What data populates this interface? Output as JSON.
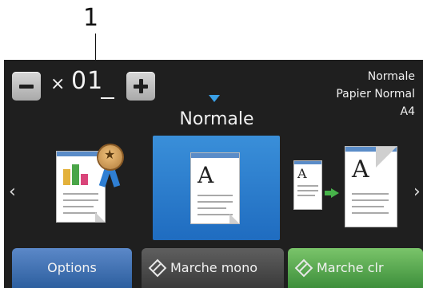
{
  "callout": {
    "number": "1"
  },
  "copies": {
    "multiplier": "×",
    "count": "01"
  },
  "settings_info": {
    "quality": "Normale",
    "paper_type": "Papier Normal",
    "paper_size": "A4"
  },
  "mode": {
    "title": "Normale"
  },
  "presets": [
    {
      "name": "best-quality-icon",
      "selected": false
    },
    {
      "name": "normal-copy-icon",
      "selected": true
    },
    {
      "name": "two-sided-copy-icon",
      "selected": false
    }
  ],
  "card_letters": {
    "normal": "A",
    "duplex_small": "A",
    "duplex_large": "A"
  },
  "buttons": {
    "options": "Options",
    "mono_start": "Marche mono",
    "color_start": "Marche clr"
  },
  "colors": {
    "selected": "#2a78cc",
    "options": "#3f70b4",
    "mono": "#4a4a4a",
    "color": "#52a84e",
    "accent": "#3aa0e6"
  }
}
